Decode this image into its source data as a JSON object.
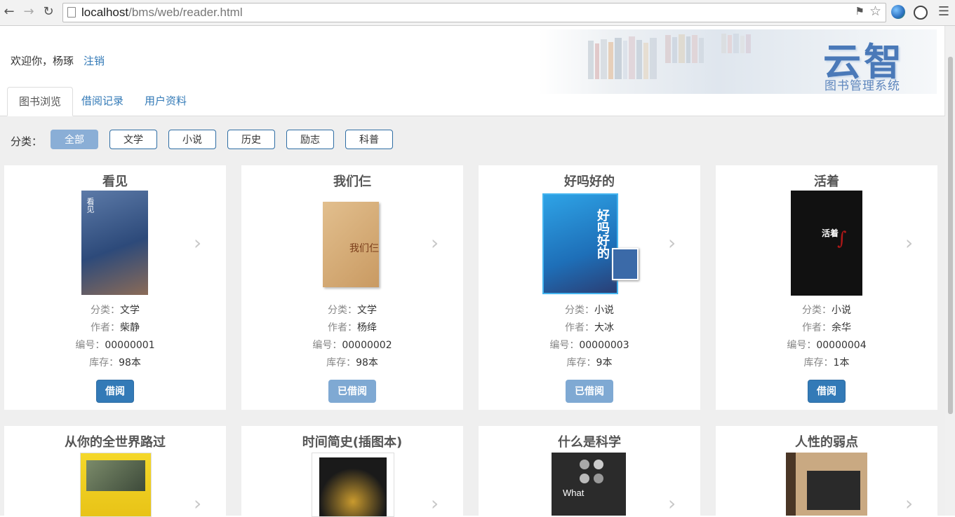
{
  "browser": {
    "url_host": "localhost",
    "url_path": "/bms/web/reader.html",
    "back_icon": "arrow-left-icon",
    "forward_icon": "arrow-right-icon",
    "reload_icon": "reload-icon"
  },
  "header": {
    "welcome": "欢迎你，杨琢",
    "logout": "注销",
    "logo_main": "云智",
    "logo_sub": "图书管理系统"
  },
  "tabs": [
    {
      "label": "图书浏览",
      "active": true
    },
    {
      "label": "借阅记录",
      "active": false
    },
    {
      "label": "用户资料",
      "active": false
    }
  ],
  "filter": {
    "label": "分类：",
    "categories": [
      {
        "label": "全部",
        "active": true
      },
      {
        "label": "文学",
        "active": false
      },
      {
        "label": "小说",
        "active": false
      },
      {
        "label": "历史",
        "active": false
      },
      {
        "label": "励志",
        "active": false
      },
      {
        "label": "科普",
        "active": false
      }
    ]
  },
  "labels": {
    "category": "分类：",
    "author": "作者：",
    "id": "编号：",
    "stock": "库存："
  },
  "books": [
    {
      "title": "看见",
      "category": "文学",
      "author": "柴静",
      "id": "00000001",
      "stock": "98本",
      "button": "借阅",
      "status": "borrow",
      "cover_color": "#2d4a7a"
    },
    {
      "title": "我们仨",
      "category": "文学",
      "author": "杨绛",
      "id": "00000002",
      "stock": "98本",
      "button": "已借阅",
      "status": "borrowed",
      "cover_color": "#d9b27e"
    },
    {
      "title": "好吗好的",
      "category": "小说",
      "author": "大冰",
      "id": "00000003",
      "stock": "9本",
      "button": "已借阅",
      "status": "borrowed",
      "cover_color": "#1e88d6"
    },
    {
      "title": "活着",
      "category": "小说",
      "author": "余华",
      "id": "00000004",
      "stock": "1本",
      "button": "借阅",
      "status": "borrow",
      "cover_color": "#111111"
    },
    {
      "title": "从你的全世界路过",
      "cover_color": "#f3d21c"
    },
    {
      "title": "时间简史(插图本)",
      "cover_color": "#151515"
    },
    {
      "title": "什么是科学",
      "cover_color": "#2b2b2b"
    },
    {
      "title": "人性的弱点",
      "cover_color": "#6b4f36"
    }
  ]
}
